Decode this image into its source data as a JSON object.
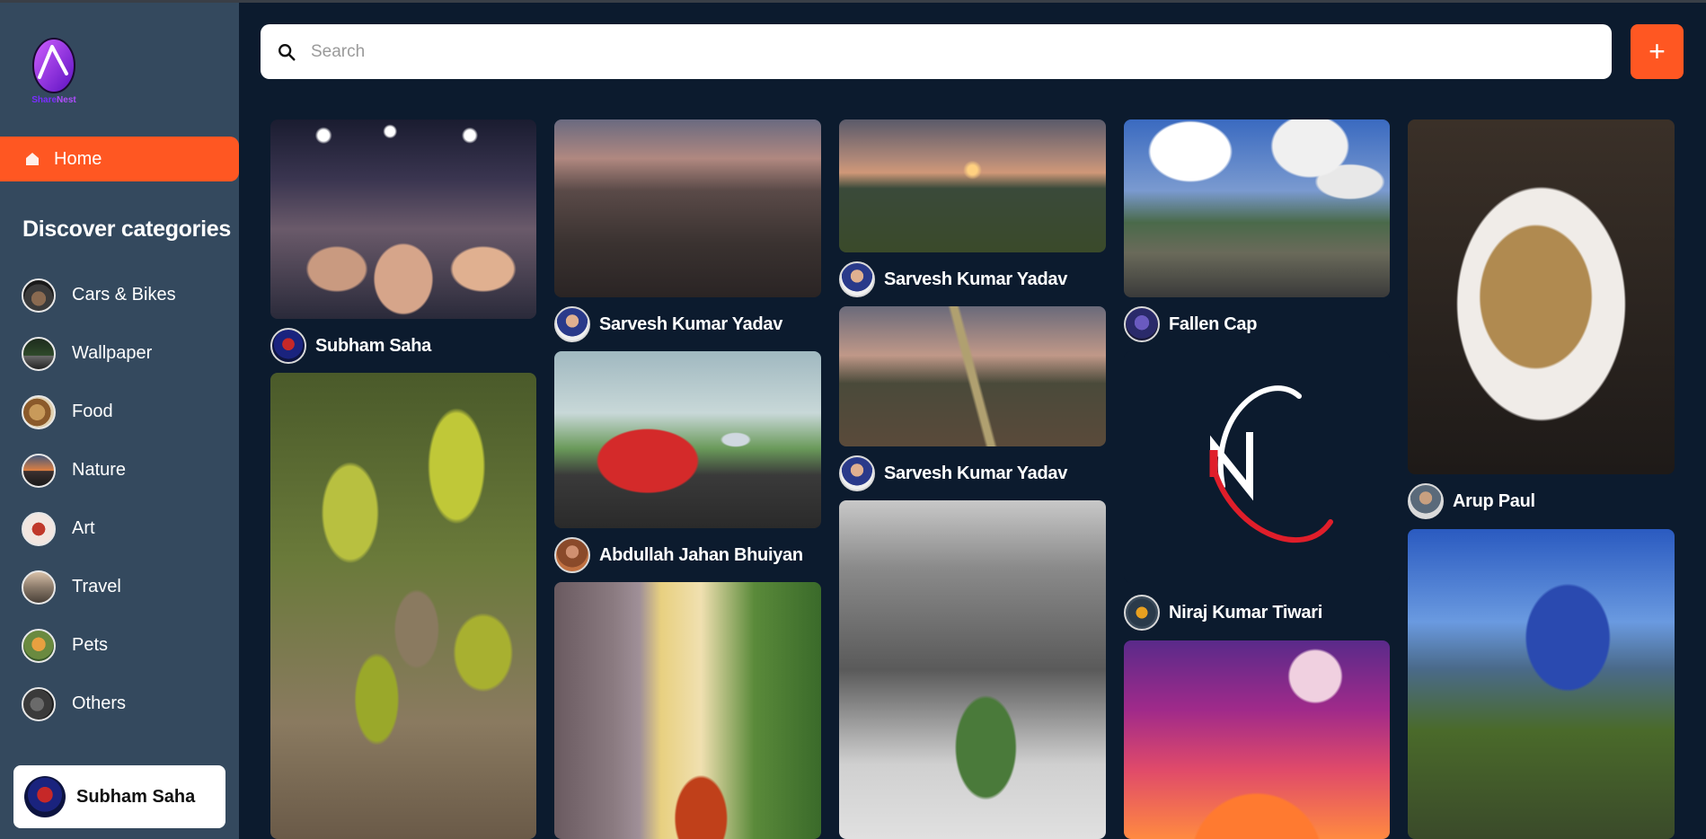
{
  "app": {
    "logo_text_part1": "Share",
    "logo_text_part2": "Nest"
  },
  "sidebar": {
    "home_label": "Home",
    "discover_title": "Discover categories",
    "categories": [
      {
        "label": "Cars & Bikes"
      },
      {
        "label": "Wallpaper"
      },
      {
        "label": "Food"
      },
      {
        "label": "Nature"
      },
      {
        "label": "Art"
      },
      {
        "label": "Travel"
      },
      {
        "label": "Pets"
      },
      {
        "label": "Others"
      }
    ],
    "user_name": "Subham Saha"
  },
  "search": {
    "placeholder": "Search",
    "add_label": "+"
  },
  "colors": {
    "accent": "#ff5722",
    "sidebar_bg": "#34495e",
    "page_bg": "#0c1b2e"
  },
  "pins": {
    "col1": [
      {
        "author": "Subham Saha",
        "image": "crowd-photo"
      },
      {
        "author": "",
        "image": "bird-nest-photo"
      }
    ],
    "col2": [
      {
        "author": "Sarvesh Kumar Yadav",
        "image": "hillside-town-photo"
      },
      {
        "author": "Abdullah Jahan Bhuiyan",
        "image": "red-car-photo"
      },
      {
        "author": "",
        "image": "butterfly-photo"
      }
    ],
    "col3": [
      {
        "author": "Sarvesh Kumar Yadav",
        "image": "sunset-field-photo"
      },
      {
        "author": "Sarvesh Kumar Yadav",
        "image": "sunset-road-photo"
      },
      {
        "author": "",
        "image": "grasshopper-photo"
      }
    ],
    "col4": [
      {
        "author": "Fallen Cap",
        "image": "railway-station-photo"
      },
      {
        "author": "Niraj Kumar Tiwari",
        "image": "n-logo-graphic"
      },
      {
        "author": "",
        "image": "moon-wallpaper"
      }
    ],
    "col5": [
      {
        "author": "Arup Paul",
        "image": "noodles-photo"
      },
      {
        "author": "",
        "image": "building-grass-photo"
      }
    ]
  }
}
